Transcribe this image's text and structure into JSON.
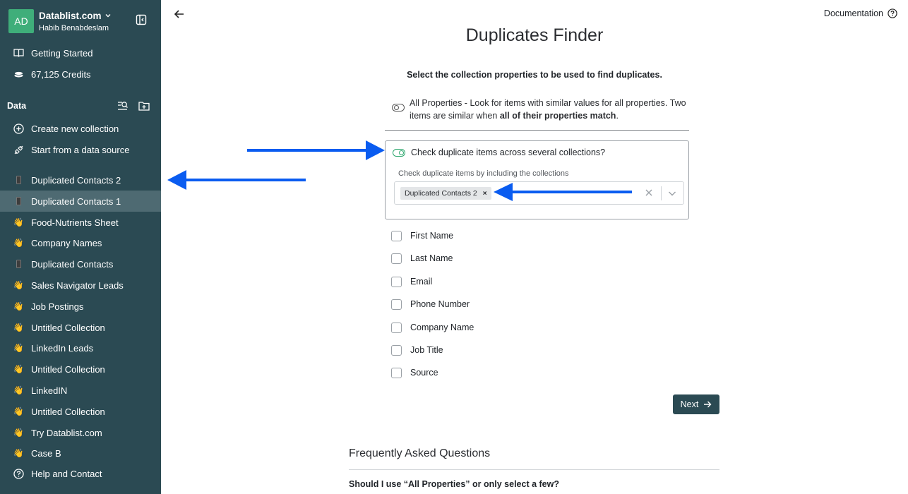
{
  "workspace": {
    "avatar_initials": "AD",
    "name": "Datablist.com",
    "user": "Habib Benabdeslam"
  },
  "sidebar": {
    "getting_started": "Getting Started",
    "credits": "67,125 Credits",
    "data_heading": "Data",
    "create_collection": "Create new collection",
    "start_data_source": "Start from a data source",
    "collections": [
      {
        "label": "Duplicated Contacts 2",
        "icon": "phone-icon"
      },
      {
        "label": "Duplicated Contacts 1",
        "icon": "phone-icon",
        "active": true
      },
      {
        "label": "Food-Nutrients Sheet",
        "icon": "waving-hand-icon"
      },
      {
        "label": "Company Names",
        "icon": "waving-hand-icon"
      },
      {
        "label": "Duplicated Contacts",
        "icon": "phone-icon"
      },
      {
        "label": "Sales Navigator Leads",
        "icon": "waving-hand-icon"
      },
      {
        "label": "Job Postings",
        "icon": "waving-hand-icon"
      },
      {
        "label": "Untitled Collection",
        "icon": "waving-hand-icon"
      },
      {
        "label": "LinkedIn Leads",
        "icon": "waving-hand-icon"
      },
      {
        "label": "Untitled Collection",
        "icon": "waving-hand-icon"
      },
      {
        "label": "LinkedIN",
        "icon": "waving-hand-icon"
      },
      {
        "label": "Untitled Collection",
        "icon": "waving-hand-icon"
      },
      {
        "label": "Try Datablist.com",
        "icon": "waving-hand-icon"
      },
      {
        "label": "Case B",
        "icon": "waving-hand-icon"
      }
    ],
    "help": "Help and Contact"
  },
  "header": {
    "documentation": "Documentation"
  },
  "main": {
    "title": "Duplicates Finder",
    "subtitle": "Select the collection properties to be used to find duplicates.",
    "all_properties_text": "All Properties - Look for items with similar values for all properties. Two items are similar when ",
    "all_properties_bold": "all of their properties match",
    "all_properties_end": ".",
    "multi_collection_label": "Check duplicate items across several collections?",
    "multi_collection_hint": "Check duplicate items by including the collections",
    "selected_collection_chip": "Duplicated Contacts 2",
    "chip_remove": "×",
    "properties": [
      "First Name",
      "Last Name",
      "Email",
      "Phone Number",
      "Company Name",
      "Job Title",
      "Source"
    ],
    "next_button": "Next"
  },
  "faq": {
    "title": "Frequently Asked Questions",
    "question_1": "Should I use “All Properties” or only select a few?"
  },
  "colors": {
    "sidebar_bg": "#2b4a53",
    "sidebar_active": "#4e6a72",
    "toggle_on": "#2fa86f",
    "annotation_arrow": "#0a5cf0",
    "avatar_bg": "#3fae7a"
  }
}
